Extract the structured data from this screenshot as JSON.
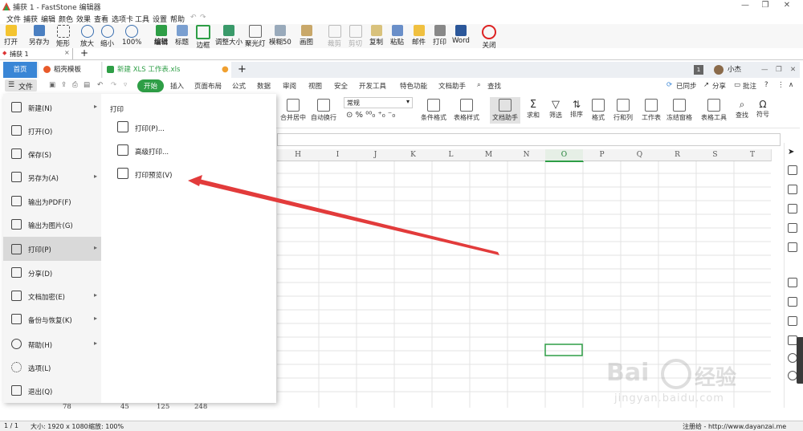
{
  "faststone": {
    "title": "捕获 1 - FastStone 编辑器",
    "menu": [
      "文件",
      "捕获",
      "编辑",
      "颜色",
      "效果",
      "查看",
      "选项卡",
      "工具",
      "设置",
      "帮助"
    ],
    "toolbar": [
      "打开",
      "另存为",
      "矩形",
      "放大",
      "缩小",
      "100%",
      "编辑",
      "标题",
      "边框",
      "调整大小",
      "聚光灯",
      "模糊50",
      "画图",
      "裁剪",
      "剪切",
      "复制",
      "粘贴",
      "邮件",
      "打印",
      "Word",
      "关闭"
    ],
    "capture_tab": "捕获 1",
    "add_tab": "+"
  },
  "wps": {
    "tabs": {
      "home": "首页",
      "template": "稻壳模板",
      "file": "新建 XLS 工作表.xls",
      "add": "+"
    },
    "user": "小杰",
    "menu": {
      "file": "文件",
      "start": "开始",
      "items": [
        "插入",
        "页面布局",
        "公式",
        "数据",
        "审阅",
        "视图",
        "安全",
        "开发工具",
        "特色功能",
        "文档助手"
      ],
      "search": "查找"
    },
    "right": {
      "sync": "已同步",
      "share": "分享",
      "comment": "批注"
    },
    "ribbon": {
      "number_format": "常规",
      "left_labels": [
        "合并居中",
        "自动换行"
      ],
      "tools": [
        "条件格式",
        "表格样式",
        "文档助手",
        "求和",
        "筛选",
        "排序",
        "格式",
        "行和列",
        "工作表",
        "冻结窗格",
        "表格工具",
        "查找",
        "符号"
      ]
    },
    "columns": [
      "H",
      "I",
      "J",
      "K",
      "L",
      "M",
      "N",
      "O",
      "P",
      "Q",
      "R",
      "S",
      "T"
    ],
    "selected_column": "O",
    "row_peek": [
      "78",
      "45",
      "125",
      "248"
    ]
  },
  "file_menu": {
    "items": [
      {
        "label": "新建(N)",
        "icon": "new-file-icon",
        "arrow": true
      },
      {
        "label": "打开(O)",
        "icon": "folder-icon",
        "arrow": false
      },
      {
        "label": "保存(S)",
        "icon": "save-icon",
        "arrow": false
      },
      {
        "label": "另存为(A)",
        "icon": "save-as-icon",
        "arrow": true
      },
      {
        "label": "输出为PDF(F)",
        "icon": "pdf-icon",
        "arrow": false
      },
      {
        "label": "输出为图片(G)",
        "icon": "image-icon",
        "arrow": false
      },
      {
        "label": "打印(P)",
        "icon": "printer-icon",
        "arrow": true
      },
      {
        "label": "分享(D)",
        "icon": "share-icon",
        "arrow": false
      },
      {
        "label": "文档加密(E)",
        "icon": "lock-icon",
        "arrow": true
      },
      {
        "label": "备份与恢复(K)",
        "icon": "backup-icon",
        "arrow": true
      },
      {
        "label": "帮助(H)",
        "icon": "help-icon",
        "arrow": true
      },
      {
        "label": "选项(L)",
        "icon": "gear-icon",
        "arrow": false
      },
      {
        "label": "退出(Q)",
        "icon": "exit-icon",
        "arrow": false
      }
    ],
    "submenu_title": "打印",
    "submenu": [
      {
        "label": "打印(P)...",
        "icon": "printer-icon"
      },
      {
        "label": "高级打印...",
        "icon": "advanced-print-icon"
      },
      {
        "label": "打印预览(V)",
        "icon": "print-preview-icon"
      }
    ]
  },
  "status": {
    "page": "1 / 1",
    "size": "大小: 1920 x 1080",
    "zoom": "缩放: 100%",
    "reg": "注册给 - http://www.dayanzai.me"
  },
  "watermark": {
    "brand": "Bai",
    "brand2": "经验",
    "url": "jingyan.baidu.com"
  },
  "colors": {
    "accent_green": "#2e9e46",
    "arrow_red": "#e23b3b",
    "tab_blue": "#3a86d6"
  }
}
